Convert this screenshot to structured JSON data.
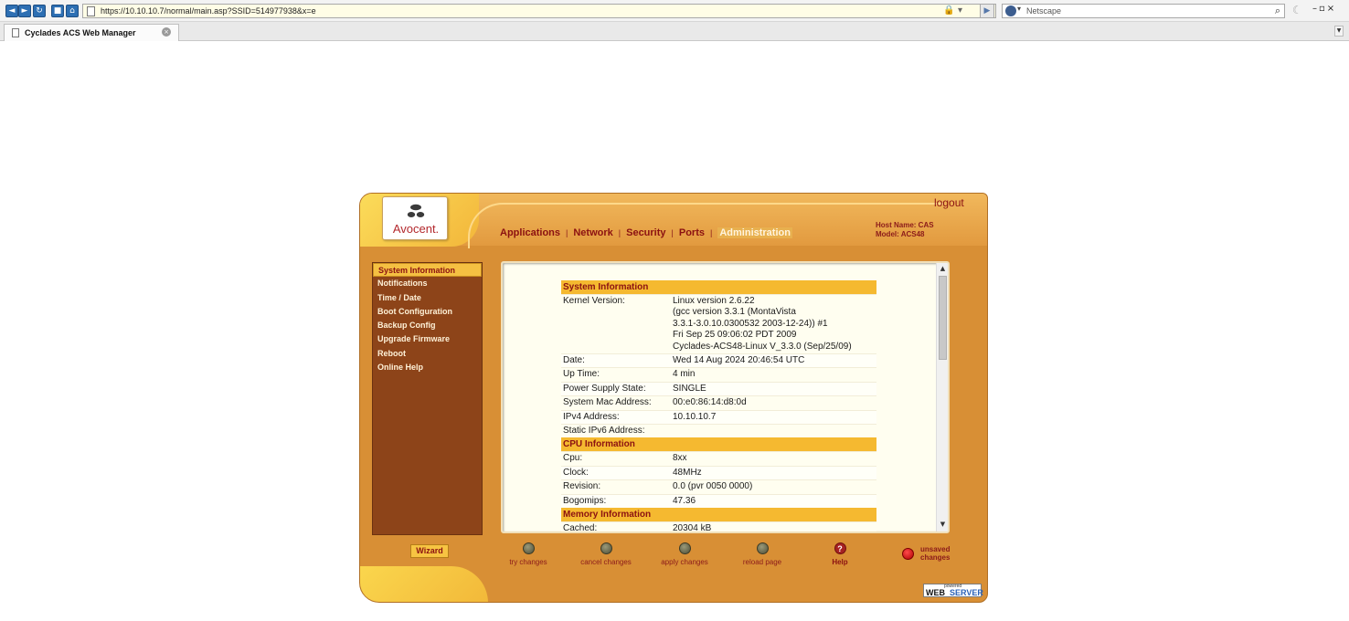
{
  "browser": {
    "url": "https://10.10.10.7/normal/main.asp?SSID=514977938&x=e",
    "search_placeholder": "Netscape",
    "tab_title": "Cyclades ACS Web Manager"
  },
  "header": {
    "logo": "Avocent.",
    "logout": "logout",
    "host_name": "Host Name: CAS",
    "model": "Model: ACS48"
  },
  "topnav": {
    "items": [
      "Applications",
      "Network",
      "Security",
      "Ports",
      "Administration"
    ],
    "active": "Administration"
  },
  "sidebar": {
    "items": [
      "System Information",
      "Notifications",
      "Time / Date",
      "Boot Configuration",
      "Backup Config",
      "Upgrade Firmware",
      "Reboot",
      "Online Help"
    ],
    "selected": "System Information"
  },
  "wizard": "Wizard",
  "system_information": {
    "title": "System Information",
    "kernel_label": "Kernel Version:",
    "kernel_lines": [
      "Linux version 2.6.22",
      "(gcc version 3.3.1 (MontaVista",
      "3.3.1-3.0.10.0300532 2003-12-24)) #1",
      "Fri Sep 25 09:06:02 PDT 2009",
      "Cyclades-ACS48-Linux V_3.3.0 (Sep/25/09)"
    ],
    "rows": [
      {
        "label": "Date:",
        "value": "Wed 14 Aug 2024 20:46:54 UTC"
      },
      {
        "label": "Up Time:",
        "value": "4 min"
      },
      {
        "label": "Power Supply State:",
        "value": "SINGLE"
      },
      {
        "label": "System Mac Address:",
        "value": "00:e0:86:14:d8:0d"
      },
      {
        "label": "IPv4 Address:",
        "value": "10.10.10.7"
      },
      {
        "label": "Static IPv6 Address:",
        "value": ""
      }
    ]
  },
  "cpu_information": {
    "title": "CPU Information",
    "rows": [
      {
        "label": "Cpu:",
        "value": "8xx"
      },
      {
        "label": "Clock:",
        "value": "48MHz"
      },
      {
        "label": "Revision:",
        "value": "0.0 (pvr 0050 0000)"
      },
      {
        "label": "Bogomips:",
        "value": "47.36"
      }
    ]
  },
  "memory_information": {
    "title": "Memory Information",
    "rows": [
      {
        "label": "Cached:",
        "value": "20304 kB"
      }
    ]
  },
  "actions": {
    "try": "try changes",
    "cancel": "cancel changes",
    "apply": "apply changes",
    "reload": "reload page",
    "help": "Help",
    "unsaved_1": "unsaved",
    "unsaved_2": "changes"
  },
  "footer_badge": {
    "small": "powered",
    "web": "WEB",
    "server": "SERVER"
  },
  "colors": {
    "frame": "#d88f35",
    "sidebar": "#8d4419",
    "accent": "#f5b930",
    "label_text": "#8b1111"
  }
}
